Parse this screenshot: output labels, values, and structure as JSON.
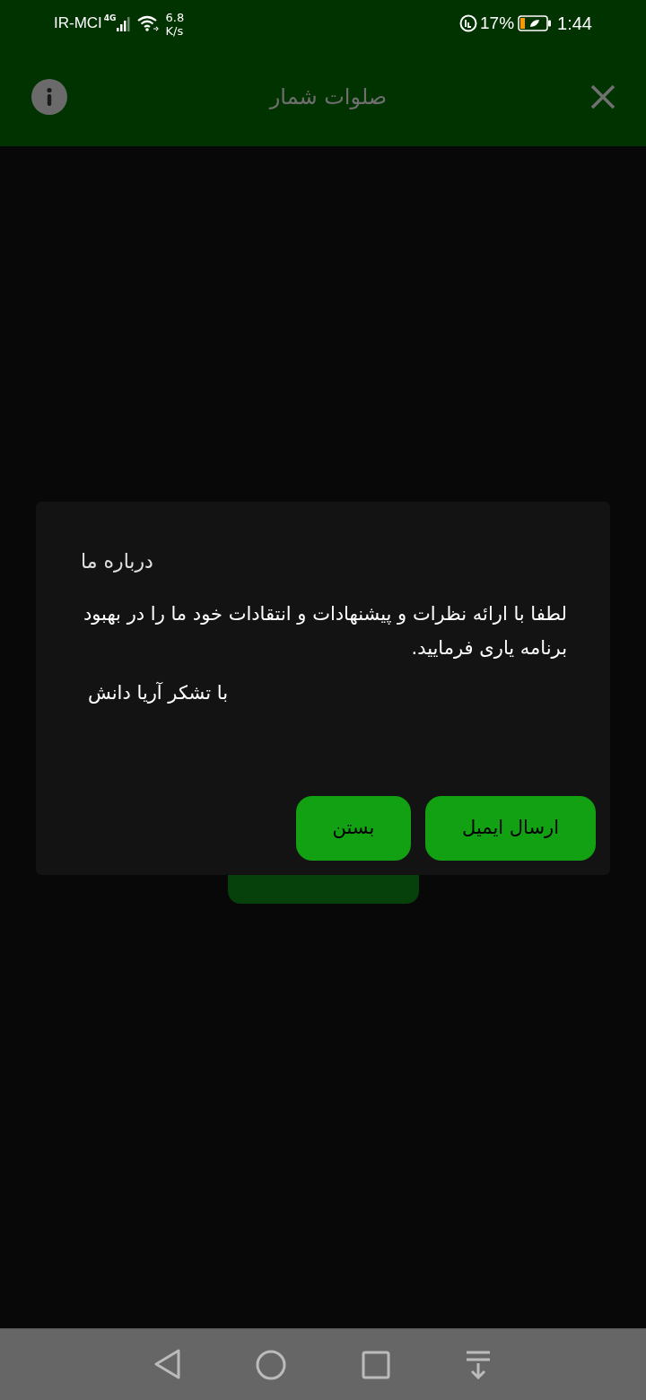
{
  "status_bar": {
    "carrier": "IR-MCI",
    "network": "4G",
    "speed_value": "6.8",
    "speed_unit": "K/s",
    "battery": "17%",
    "time": "1:44"
  },
  "app_bar": {
    "title": "صلوات شمار"
  },
  "dialog": {
    "title": "درباره ما",
    "message": "لطفا با ارائه نظرات و پیشنهادات و انتقادات خود ما را در بهبود برنامه یاری فرمایید.",
    "thanks": "با تشکر آریا دانش",
    "buttons": [
      {
        "label": "ارسال ایمیل"
      },
      {
        "label": "بستن"
      }
    ]
  }
}
